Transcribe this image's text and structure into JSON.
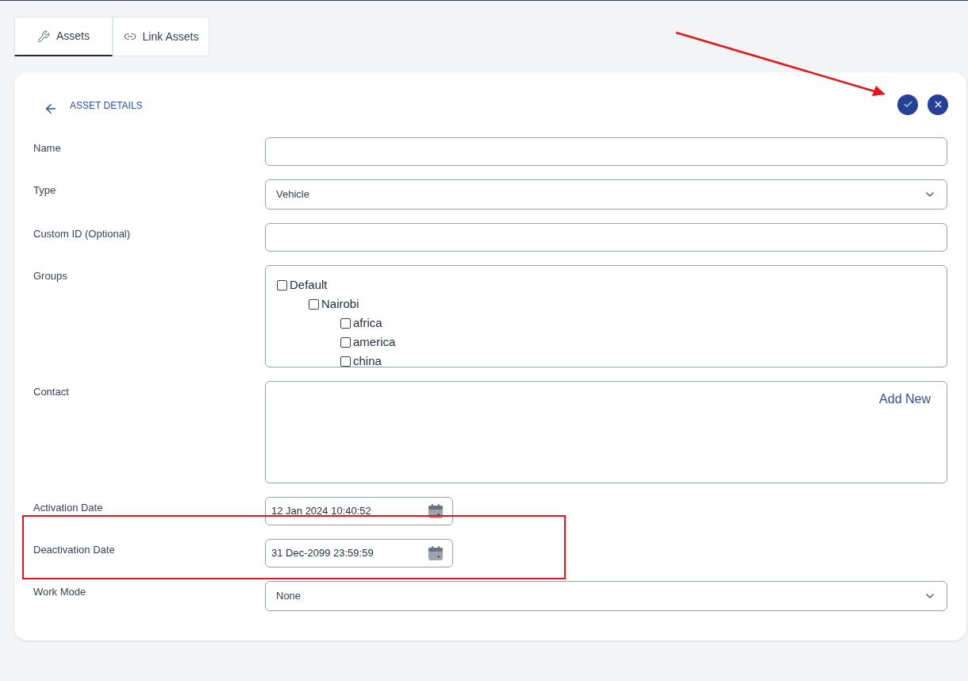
{
  "tabs": [
    {
      "label": "Assets",
      "kind": "tools",
      "selected": true
    },
    {
      "label": "Link Assets",
      "kind": "links",
      "selected": false
    }
  ],
  "panel": {
    "title": "ASSET DETAILS",
    "actions": [
      {
        "kind": "confirm"
      },
      {
        "kind": "close"
      }
    ]
  },
  "fields": [
    {
      "label": "Name",
      "kind": "text"
    },
    {
      "label": "Type",
      "kind": "select",
      "value": "Vehicle"
    },
    {
      "label": "Custom ID (Optional)",
      "kind": "text"
    },
    {
      "label": "Groups",
      "kind": "tree",
      "items": [
        {
          "label": "Default",
          "checked": false,
          "children": [
            {
              "label": "Nairobi",
              "checked": false,
              "children": [
                {
                  "label": "africa",
                  "checked": false
                },
                {
                  "label": "america",
                  "checked": false
                },
                {
                  "label": "china",
                  "checked": false
                }
              ]
            }
          ]
        }
      ]
    },
    {
      "label": "Contact",
      "kind": "contact",
      "link": "Add New"
    },
    {
      "label": "Activation Date",
      "kind": "date",
      "value": "12 Jan 2024 10:40:52"
    },
    {
      "label": "Deactivation Date",
      "kind": "date",
      "value": "31 Dec-2099 23:59:59"
    },
    {
      "label": "Work Mode",
      "kind": "select",
      "value": "None"
    }
  ]
}
